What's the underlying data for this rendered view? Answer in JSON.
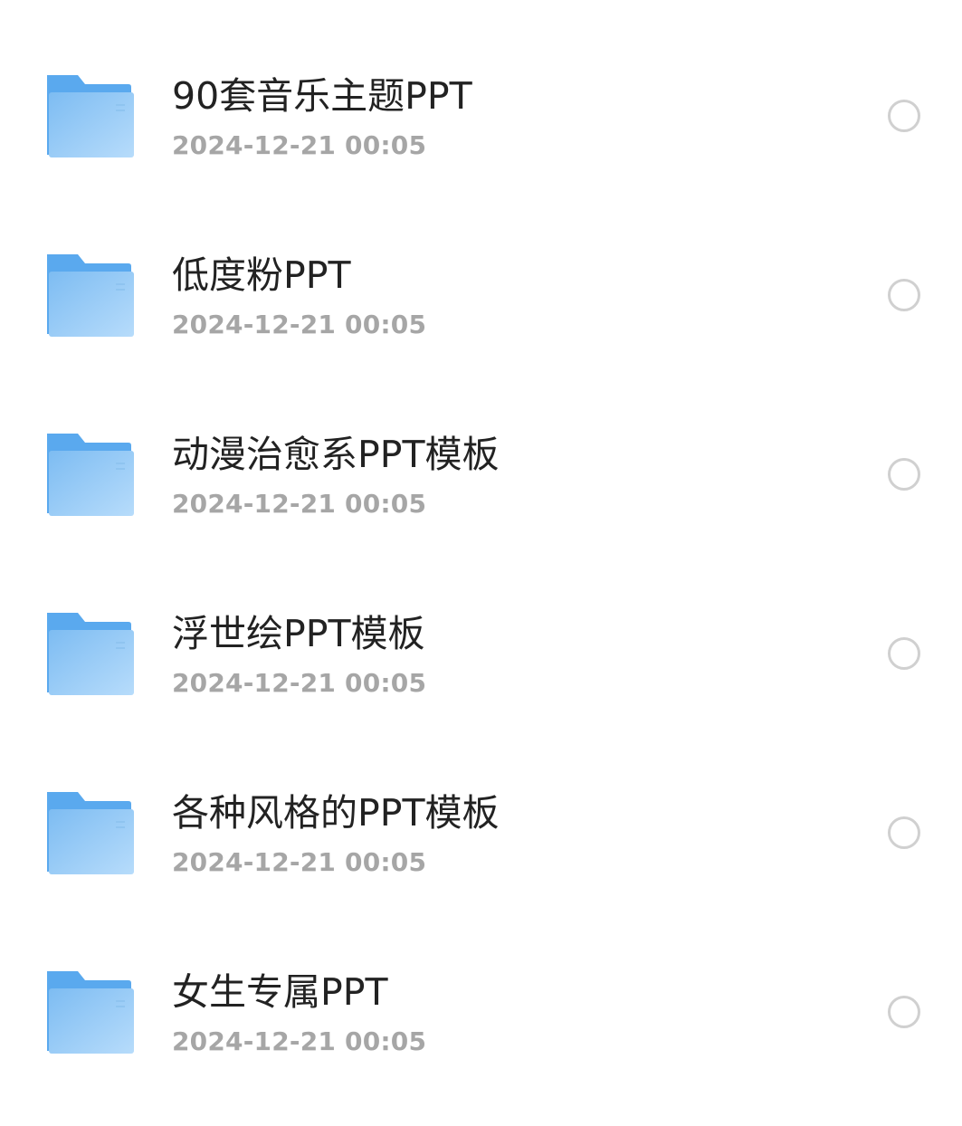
{
  "folders": [
    {
      "name": "90套音乐主题PPT",
      "date": "2024-12-21 00:05",
      "icon": "folder-icon",
      "selected": false
    },
    {
      "name": "低度粉PPT",
      "date": "2024-12-21 00:05",
      "icon": "folder-icon",
      "selected": false
    },
    {
      "name": "动漫治愈系PPT模板",
      "date": "2024-12-21 00:05",
      "icon": "folder-icon",
      "selected": false
    },
    {
      "name": "浮世绘PPT模板",
      "date": "2024-12-21 00:05",
      "icon": "folder-icon",
      "selected": false
    },
    {
      "name": "各种风格的PPT模板",
      "date": "2024-12-21 00:05",
      "icon": "folder-icon",
      "selected": false
    },
    {
      "name": "女生专属PPT",
      "date": "2024-12-21 00:05",
      "icon": "folder-icon",
      "selected": false
    }
  ],
  "colors": {
    "folder_back": "#5aa9ee",
    "folder_front_start": "#7dbcf2",
    "folder_front_end": "#b7dcfb",
    "title": "#222222",
    "date": "#a6a6a6",
    "radio_border": "#d0d0d0"
  }
}
